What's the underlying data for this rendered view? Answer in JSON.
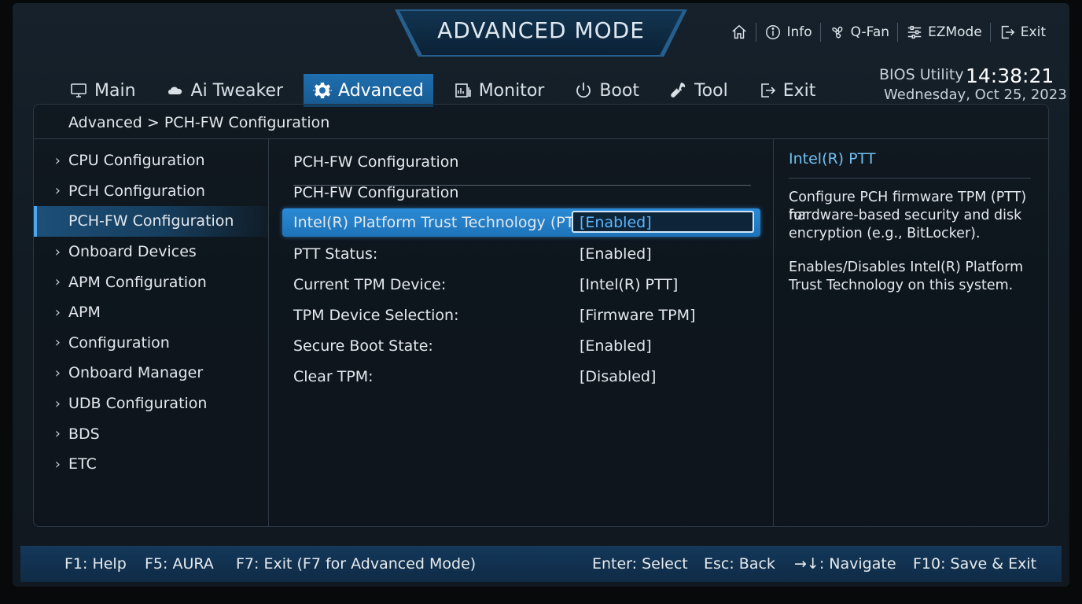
{
  "header": {
    "title": "ADVANCED MODE",
    "top_menu": [
      {
        "icon": "home-icon",
        "label": ""
      },
      {
        "icon": "info-icon",
        "label": "Info"
      },
      {
        "icon": "fan-icon",
        "label": "Q-Fan"
      },
      {
        "icon": "sliders-icon",
        "label": "EZMode"
      },
      {
        "icon": "exit-icon",
        "label": "Exit"
      }
    ],
    "bios_label": "BIOS Utility",
    "time": "14:38:21",
    "date": "Wednesday,  Oct 25, 2023"
  },
  "tabs": [
    {
      "label": "Main",
      "icon": "monitor-icon"
    },
    {
      "label": "Ai Tweaker",
      "icon": "cloud-icon"
    },
    {
      "label": "Advanced",
      "icon": "gear-icon",
      "active": true
    },
    {
      "label": "Monitor",
      "icon": "chart-icon"
    },
    {
      "label": "Boot",
      "icon": "power-icon"
    },
    {
      "label": "Tool",
      "icon": "wrench-icon"
    },
    {
      "label": "Exit",
      "icon": "exit-icon"
    }
  ],
  "breadcrumb": "Advanced > PCH-FW Configuration",
  "sidebar": {
    "items": [
      {
        "label": "CPU Configuration",
        "chevron": true
      },
      {
        "label": "PCH Configuration",
        "chevron": true
      },
      {
        "label": "PCH-FW Configuration",
        "chevron": false,
        "selected": true
      },
      {
        "label": "Onboard Devices",
        "chevron": true
      },
      {
        "label": "APM Configuration",
        "chevron": true
      },
      {
        "label": "APM",
        "chevron": true
      },
      {
        "label": "Configuration",
        "chevron": true
      },
      {
        "label": "Onboard Manager",
        "chevron": true
      },
      {
        "label": "UDB Configuration",
        "chevron": true
      },
      {
        "label": "BDS",
        "chevron": true
      },
      {
        "label": "ETC",
        "chevron": true
      }
    ]
  },
  "main": {
    "heading1": "PCH-FW Configuration",
    "heading2": "PCH-FW Configuration",
    "settings": [
      {
        "label": "Intel(R) Platform Trust Technology (PTT)",
        "value": "[Enabled]",
        "highlight": true
      },
      {
        "label": "PTT Status:",
        "value": "[Enabled]"
      },
      {
        "label": "Current TPM Device:",
        "value": "[Intel(R) PTT]"
      },
      {
        "label": "TPM Device Selection:",
        "value": "[Firmware TPM]"
      },
      {
        "label": "Secure Boot State:",
        "value": "[Enabled]"
      },
      {
        "label": "Clear TPM:",
        "value": "[Disabled]"
      }
    ]
  },
  "help": {
    "title": "Intel(R) PTT",
    "line1": "Configure PCH firmware TPM (PTT) for",
    "line2": "hardware-based security and disk",
    "line3": "encryption (e.g., BitLocker).",
    "line4": "Enables/Disables Intel(R) Platform",
    "line5": "Trust Technology on this system."
  },
  "footer": {
    "help": "F1: Help",
    "aura": "F5: AURA",
    "exit_mode": "F7: Exit (F7 for Advanced Mode)",
    "select": "Enter: Select",
    "back": "Esc: Back",
    "navigate": "→↓: Navigate",
    "save_exit": "F10: Save & Exit"
  },
  "colors": {
    "accent": "#1f6fb0",
    "help_title": "#6fc0f2",
    "selected_value": "#5cb6ff"
  }
}
